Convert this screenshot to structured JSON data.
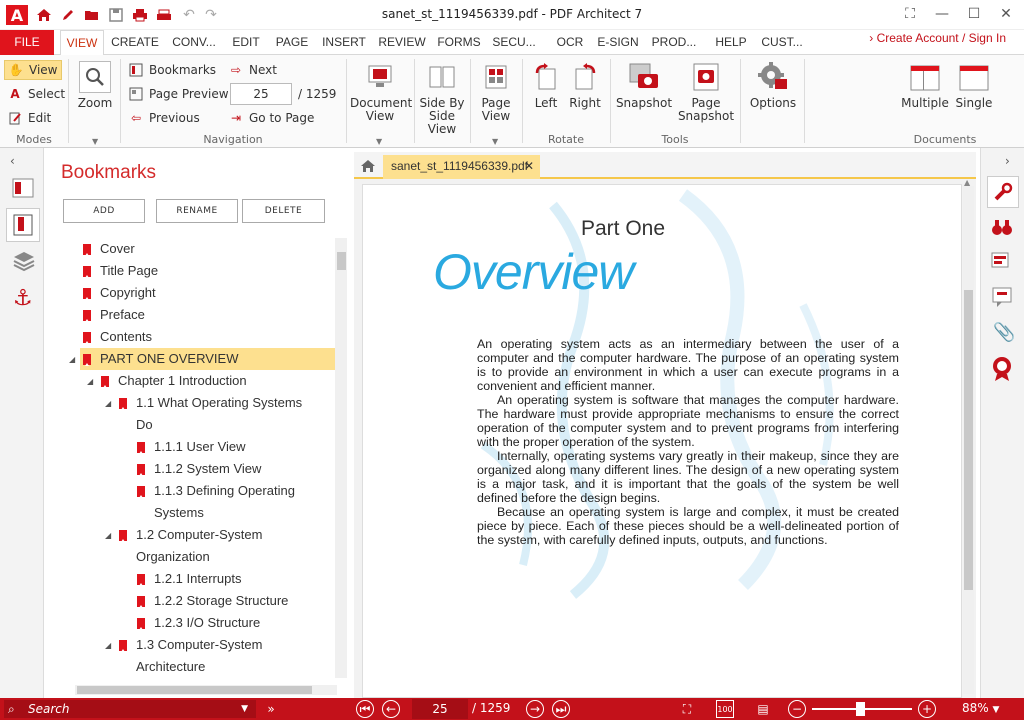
{
  "window": {
    "title": "sanet_st_1119456339.pdf   -   PDF Architect 7"
  },
  "quick_access": [
    "app-logo-icon",
    "home-icon",
    "pen-icon",
    "open-folder-icon",
    "save-icon",
    "print-icon",
    "scan-icon",
    "undo-icon",
    "redo-icon"
  ],
  "ribbon_tabs": [
    "FILE",
    "VIEW",
    "CREATE",
    "CONV...",
    "EDIT",
    "PAGE",
    "INSERT",
    "REVIEW",
    "FORMS",
    "SECU...",
    "OCR",
    "E-SIGN",
    "PROD...",
    "HELP",
    "CUST..."
  ],
  "account_link": "Create Account / Sign In",
  "ribbon": {
    "modes": {
      "label": "Modes",
      "view": "View",
      "select": "Select",
      "edit": "Edit"
    },
    "zoom": {
      "label": "Zoom"
    },
    "navigation": {
      "label": "Navigation",
      "bookmarks": "Bookmarks",
      "page_preview": "Page Preview",
      "previous": "Previous",
      "next": "Next",
      "go_to_page": "Go to Page",
      "current_page": "25",
      "total_pages": "/  1259"
    },
    "document_view": "Document View",
    "side_by_side": "Side By Side View",
    "page_view": "Page View",
    "rotate": {
      "label": "Rotate",
      "left": "Left",
      "right": "Right"
    },
    "tools": {
      "label": "Tools",
      "snapshot": "Snapshot",
      "page_snapshot": "Page Snapshot"
    },
    "options": "Options",
    "documents": {
      "label": "Documents",
      "multiple": "Multiple",
      "single": "Single"
    }
  },
  "bookmarks": {
    "title": "Bookmarks",
    "buttons": {
      "add": "ADD",
      "rename": "RENAME",
      "delete": "DELETE"
    },
    "items": [
      {
        "label": "Cover"
      },
      {
        "label": "Title Page"
      },
      {
        "label": "Copyright"
      },
      {
        "label": "Preface"
      },
      {
        "label": "Contents"
      },
      {
        "label": "PART ONE OVERVIEW"
      },
      {
        "label": "Chapter 1 Introduction"
      },
      {
        "label": "1.1 What Operating Systems",
        "label2": "Do"
      },
      {
        "label": "1.1.1 User View"
      },
      {
        "label": "1.1.2 System View"
      },
      {
        "label": "1.1.3 Defining Operating",
        "label2": "Systems"
      },
      {
        "label": "1.2 Computer-System",
        "label2": "Organization"
      },
      {
        "label": "1.2.1 Interrupts"
      },
      {
        "label": "1.2.2 Storage Structure"
      },
      {
        "label": "1.2.3 I/O Structure"
      },
      {
        "label": "1.3 Computer-System",
        "label2": "Architecture"
      }
    ]
  },
  "document": {
    "tab_name": "sanet_st_1119456339.pdf",
    "heading": "Part One",
    "overview": "Overview",
    "paragraphs": [
      "An operating system acts as an intermediary between the user of a computer and the computer hardware. The purpose of an operating system is to provide an environment in which a user can execute programs in a convenient and efficient manner.",
      "An operating system is software that manages the computer hardware. The hardware must provide appropriate mechanisms to ensure the correct operation of the computer system and to prevent programs from interfering with the proper operation of the system.",
      "Internally, operating systems vary greatly in their makeup, since they are organized along many different lines. The design of a new operating system is a major task, and it is important that the goals of the system be well defined before the design begins.",
      "Because an operating system is large and complex, it must be created piece by piece. Each of these pieces should be a well-delineated portion of the system, with carefully defined inputs, outputs, and functions."
    ]
  },
  "statusbar": {
    "search_placeholder": "Search",
    "current_page": "25",
    "total_pages": "/ 1259",
    "zoom": "88%"
  },
  "colors": {
    "accent": "#e0141c",
    "status": "#c3111a",
    "highlight": "#fde08f",
    "overview": "#2aa9e0"
  }
}
